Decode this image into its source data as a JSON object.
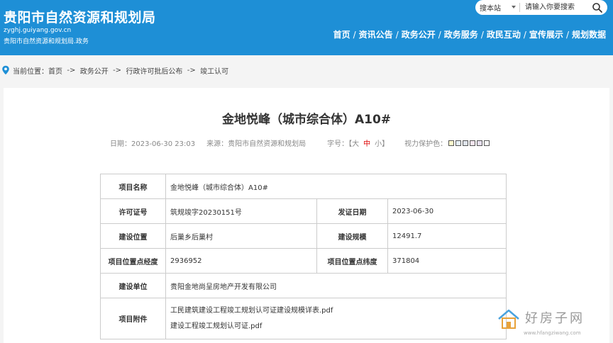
{
  "header": {
    "title": "贵阳市自然资源和规划局",
    "domain": "zyghj.guiyang.gov.cn",
    "subtitle": "贵阳市自然资源和规划局.政务",
    "search_scope": "搜本站",
    "search_placeholder": "请输入你要搜索",
    "nav": [
      "首页",
      "资讯公告",
      "政务公开",
      "政务服务",
      "政民互动",
      "宣传展示",
      "规划数据"
    ],
    "color": "#1e8fd6"
  },
  "breadcrumb": {
    "label": "当前位置：",
    "items": [
      "首页",
      "政务公开",
      "行政许可批后公布",
      "竣工认可"
    ],
    "arrow": "->"
  },
  "article": {
    "title": "金地悦峰（城市综合体）A10#",
    "date": "日期：2023-06-30 23:03",
    "source": "来源：贵阳市自然资源和规划局",
    "font_label": "字号：【",
    "font_big": "大",
    "font_mid": "中",
    "font_small": "小",
    "font_end": "】",
    "vision_label": "视力保护色：",
    "vision_colors": [
      "#fffacd",
      "#e6f0f8",
      "#dfe4ec",
      "#f5e6f0",
      "#e8e0f0",
      "#ffffff"
    ]
  },
  "table": {
    "r1": {
      "l1": "项目名称",
      "v1": "金地悦峰（城市综合体）A10#"
    },
    "r2": {
      "l1": "许可证号",
      "v1": "筑规竣字20230151号",
      "l2": "发证日期",
      "v2": "2023-06-30"
    },
    "r3": {
      "l1": "建设位置",
      "v1": "后巢乡后巢村",
      "l2": "建设规模",
      "v2": "12491.7"
    },
    "r4": {
      "l1": "项目位置点经度",
      "v1": "2936952",
      "l2": "项目位置点纬度",
      "v2": "371804"
    },
    "r5": {
      "l1": "建设单位",
      "v1": "贵阳金地尚呈房地产开发有限公司"
    },
    "r6": {
      "l1": "项目附件",
      "files": [
        "工民建筑建设工程竣工规划认可证建设规模详表.pdf",
        "建设工程竣工规划认可证.pdf"
      ]
    }
  },
  "watermark": {
    "text": "好房子网",
    "url": "www.hfangziwang.com"
  }
}
